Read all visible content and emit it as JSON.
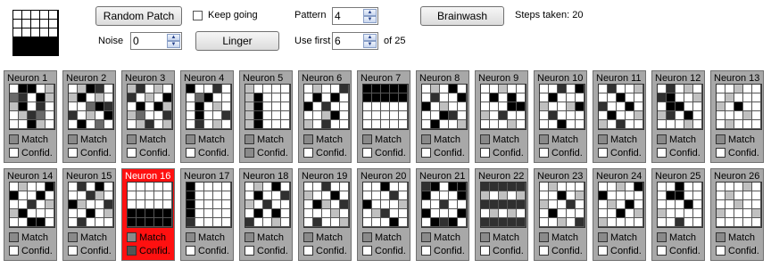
{
  "controls": {
    "random_patch_label": "Random Patch",
    "keep_going_label": "Keep going",
    "pattern_label": "Pattern",
    "pattern_value": "4",
    "brainwash_label": "Brainwash",
    "steps_label": "Steps taken: 20",
    "noise_label": "Noise",
    "noise_value": "0",
    "linger_label": "Linger",
    "use_first_label": "Use first",
    "use_first_value": "6",
    "of_total_label": "of 25"
  },
  "current_pattern": [
    [
      1,
      1,
      1,
      1,
      1
    ],
    [
      1,
      1,
      1,
      1,
      1
    ],
    [
      1,
      1,
      1,
      1,
      1
    ],
    [
      0,
      0,
      0,
      0,
      0
    ],
    [
      0,
      0,
      0,
      0,
      0
    ]
  ],
  "colors": {
    "panel_bg": "#a8a8a8",
    "highlight_bg": "#ff1010",
    "match_square": "#8a8a8a",
    "confid_square": "#ffffff"
  },
  "neurons": [
    {
      "name": "Neuron 1",
      "highlight": false,
      "confid": "#ffffff",
      "cells": [
        [
          4,
          0,
          0,
          4,
          3
        ],
        [
          2,
          1,
          4,
          0,
          3
        ],
        [
          3,
          0,
          4,
          1,
          4
        ],
        [
          4,
          3,
          1,
          2,
          4
        ],
        [
          4,
          4,
          0,
          3,
          4
        ]
      ]
    },
    {
      "name": "Neuron 2",
      "highlight": false,
      "confid": "#ffffff",
      "cells": [
        [
          4,
          3,
          0,
          1,
          4
        ],
        [
          3,
          0,
          4,
          3,
          4
        ],
        [
          4,
          4,
          2,
          0,
          1
        ],
        [
          1,
          4,
          3,
          4,
          0
        ],
        [
          4,
          0,
          4,
          2,
          4
        ]
      ]
    },
    {
      "name": "Neuron 3",
      "highlight": false,
      "confid": "#ffffff",
      "cells": [
        [
          3,
          1,
          4,
          3,
          4
        ],
        [
          1,
          4,
          3,
          4,
          0
        ],
        [
          4,
          0,
          4,
          0,
          3
        ],
        [
          3,
          2,
          4,
          4,
          1
        ],
        [
          4,
          3,
          1,
          4,
          3
        ]
      ]
    },
    {
      "name": "Neuron 4",
      "highlight": false,
      "confid": "#ffffff",
      "cells": [
        [
          0,
          4,
          4,
          1,
          4
        ],
        [
          4,
          2,
          0,
          4,
          4
        ],
        [
          4,
          0,
          4,
          3,
          4
        ],
        [
          4,
          0,
          4,
          4,
          1
        ],
        [
          4,
          1,
          4,
          3,
          4
        ]
      ]
    },
    {
      "name": "Neuron 5",
      "highlight": false,
      "confid": "#8a8a8a",
      "cells": [
        [
          3,
          4,
          4,
          4,
          4
        ],
        [
          3,
          0,
          4,
          4,
          4
        ],
        [
          3,
          0,
          4,
          4,
          4
        ],
        [
          3,
          0,
          4,
          4,
          4
        ],
        [
          3,
          0,
          4,
          4,
          4
        ]
      ]
    },
    {
      "name": "Neuron 6",
      "highlight": false,
      "confid": "#ffffff",
      "cells": [
        [
          4,
          3,
          4,
          4,
          1
        ],
        [
          4,
          0,
          4,
          0,
          4
        ],
        [
          0,
          4,
          1,
          4,
          4
        ],
        [
          4,
          4,
          3,
          0,
          4
        ],
        [
          3,
          4,
          1,
          4,
          4
        ]
      ]
    },
    {
      "name": "Neuron 7",
      "highlight": false,
      "confid": "#ffffff",
      "cells": [
        [
          0,
          0,
          0,
          0,
          0
        ],
        [
          0,
          0,
          0,
          0,
          0
        ],
        [
          4,
          4,
          4,
          4,
          4
        ],
        [
          4,
          4,
          4,
          4,
          4
        ],
        [
          4,
          4,
          4,
          4,
          4
        ]
      ]
    },
    {
      "name": "Neuron 8",
      "highlight": false,
      "confid": "#ffffff",
      "cells": [
        [
          4,
          3,
          4,
          0,
          4
        ],
        [
          4,
          1,
          4,
          4,
          0
        ],
        [
          0,
          4,
          3,
          4,
          4
        ],
        [
          4,
          4,
          0,
          1,
          4
        ],
        [
          4,
          0,
          4,
          4,
          3
        ]
      ]
    },
    {
      "name": "Neuron 9",
      "highlight": false,
      "confid": "#ffffff",
      "cells": [
        [
          4,
          4,
          3,
          4,
          4
        ],
        [
          4,
          0,
          4,
          0,
          4
        ],
        [
          4,
          4,
          4,
          0,
          0
        ],
        [
          3,
          4,
          1,
          4,
          4
        ],
        [
          4,
          4,
          4,
          3,
          4
        ]
      ]
    },
    {
      "name": "Neuron 10",
      "highlight": false,
      "confid": "#ffffff",
      "cells": [
        [
          4,
          4,
          1,
          4,
          0
        ],
        [
          4,
          0,
          4,
          4,
          4
        ],
        [
          3,
          4,
          4,
          3,
          0
        ],
        [
          4,
          1,
          4,
          4,
          4
        ],
        [
          4,
          4,
          0,
          4,
          4
        ]
      ]
    },
    {
      "name": "Neuron 11",
      "highlight": false,
      "confid": "#ffffff",
      "cells": [
        [
          4,
          1,
          4,
          4,
          3
        ],
        [
          4,
          4,
          0,
          4,
          4
        ],
        [
          1,
          4,
          4,
          0,
          4
        ],
        [
          4,
          0,
          4,
          4,
          3
        ],
        [
          3,
          4,
          1,
          4,
          4
        ]
      ]
    },
    {
      "name": "Neuron 12",
      "highlight": false,
      "confid": "#ffffff",
      "cells": [
        [
          4,
          1,
          4,
          3,
          4
        ],
        [
          1,
          0,
          4,
          4,
          3
        ],
        [
          4,
          0,
          0,
          4,
          4
        ],
        [
          3,
          1,
          4,
          0,
          4
        ],
        [
          4,
          4,
          4,
          3,
          4
        ]
      ]
    },
    {
      "name": "Neuron 13",
      "highlight": false,
      "confid": "#ffffff",
      "cells": [
        [
          4,
          4,
          3,
          4,
          4
        ],
        [
          4,
          3,
          4,
          4,
          4
        ],
        [
          3,
          4,
          0,
          4,
          4
        ],
        [
          4,
          4,
          4,
          3,
          4
        ],
        [
          4,
          3,
          4,
          4,
          4
        ]
      ]
    },
    {
      "name": "Neuron 14",
      "highlight": false,
      "confid": "#ffffff",
      "cells": [
        [
          4,
          3,
          4,
          4,
          0
        ],
        [
          0,
          4,
          4,
          0,
          4
        ],
        [
          4,
          4,
          1,
          4,
          3
        ],
        [
          3,
          0,
          4,
          4,
          4
        ],
        [
          4,
          4,
          0,
          0,
          4
        ]
      ]
    },
    {
      "name": "Neuron 15",
      "highlight": false,
      "confid": "#ffffff",
      "cells": [
        [
          4,
          1,
          4,
          0,
          4
        ],
        [
          4,
          4,
          1,
          3,
          4
        ],
        [
          0,
          3,
          4,
          4,
          1
        ],
        [
          4,
          4,
          0,
          4,
          3
        ],
        [
          4,
          1,
          4,
          4,
          4
        ]
      ]
    },
    {
      "name": "Neuron 16",
      "highlight": true,
      "confid": "#555555",
      "cells": [
        [
          4,
          4,
          4,
          4,
          4
        ],
        [
          4,
          4,
          4,
          4,
          4
        ],
        [
          4,
          4,
          4,
          4,
          4
        ],
        [
          0,
          0,
          0,
          0,
          0
        ],
        [
          0,
          0,
          0,
          0,
          0
        ]
      ]
    },
    {
      "name": "Neuron 17",
      "highlight": false,
      "confid": "#ffffff",
      "cells": [
        [
          0,
          4,
          4,
          4,
          4
        ],
        [
          0,
          4,
          4,
          4,
          4
        ],
        [
          0,
          4,
          4,
          4,
          4
        ],
        [
          0,
          4,
          4,
          4,
          4
        ],
        [
          1,
          4,
          4,
          4,
          4
        ]
      ]
    },
    {
      "name": "Neuron 18",
      "highlight": false,
      "confid": "#ffffff",
      "cells": [
        [
          4,
          3,
          4,
          0,
          4
        ],
        [
          4,
          0,
          4,
          4,
          1
        ],
        [
          3,
          4,
          1,
          4,
          4
        ],
        [
          4,
          0,
          4,
          0,
          4
        ],
        [
          1,
          4,
          4,
          3,
          4
        ]
      ]
    },
    {
      "name": "Neuron 19",
      "highlight": false,
      "confid": "#ffffff",
      "cells": [
        [
          4,
          4,
          1,
          4,
          4
        ],
        [
          3,
          4,
          4,
          0,
          4
        ],
        [
          4,
          0,
          3,
          4,
          1
        ],
        [
          4,
          4,
          4,
          3,
          4
        ],
        [
          4,
          1,
          4,
          4,
          3
        ]
      ]
    },
    {
      "name": "Neuron 20",
      "highlight": false,
      "confid": "#ffffff",
      "cells": [
        [
          4,
          4,
          0,
          4,
          4
        ],
        [
          4,
          4,
          4,
          1,
          4
        ],
        [
          0,
          4,
          4,
          4,
          3
        ],
        [
          4,
          3,
          1,
          4,
          4
        ],
        [
          4,
          4,
          4,
          0,
          4
        ]
      ]
    },
    {
      "name": "Neuron 21",
      "highlight": false,
      "confid": "#ffffff",
      "cells": [
        [
          1,
          0,
          4,
          0,
          0
        ],
        [
          0,
          4,
          4,
          4,
          0
        ],
        [
          4,
          4,
          1,
          4,
          4
        ],
        [
          0,
          4,
          4,
          4,
          0
        ],
        [
          4,
          0,
          1,
          0,
          4
        ]
      ]
    },
    {
      "name": "Neuron 22",
      "highlight": false,
      "confid": "#ffffff",
      "cells": [
        [
          1,
          1,
          1,
          1,
          1
        ],
        [
          3,
          4,
          3,
          4,
          3
        ],
        [
          1,
          1,
          1,
          1,
          1
        ],
        [
          4,
          3,
          4,
          3,
          4
        ],
        [
          1,
          1,
          1,
          1,
          1
        ]
      ]
    },
    {
      "name": "Neuron 23",
      "highlight": false,
      "confid": "#ffffff",
      "cells": [
        [
          4,
          3,
          4,
          4,
          4
        ],
        [
          4,
          4,
          0,
          4,
          3
        ],
        [
          3,
          4,
          4,
          1,
          4
        ],
        [
          4,
          0,
          4,
          4,
          4
        ],
        [
          4,
          4,
          3,
          4,
          1
        ]
      ]
    },
    {
      "name": "Neuron 24",
      "highlight": false,
      "confid": "#ffffff",
      "cells": [
        [
          4,
          4,
          3,
          4,
          0
        ],
        [
          0,
          4,
          4,
          4,
          4
        ],
        [
          4,
          3,
          4,
          0,
          4
        ],
        [
          4,
          4,
          0,
          4,
          3
        ],
        [
          3,
          4,
          4,
          4,
          4
        ]
      ]
    },
    {
      "name": "Neuron 25",
      "highlight": false,
      "confid": "#ffffff",
      "cells": [
        [
          4,
          4,
          0,
          4,
          4
        ],
        [
          4,
          0,
          0,
          4,
          4
        ],
        [
          4,
          4,
          4,
          0,
          4
        ],
        [
          3,
          4,
          4,
          4,
          4
        ],
        [
          4,
          4,
          1,
          4,
          4
        ]
      ]
    },
    {
      "name": "Neuron 26",
      "highlight": false,
      "confid": "#ffffff",
      "cells": [
        [
          4,
          4,
          4,
          3,
          4
        ],
        [
          4,
          3,
          4,
          4,
          4
        ],
        [
          4,
          4,
          3,
          4,
          4
        ],
        [
          3,
          4,
          4,
          4,
          3
        ],
        [
          4,
          4,
          4,
          4,
          4
        ]
      ]
    }
  ],
  "panel_labels": {
    "match": "Match",
    "confid": "Confid."
  }
}
